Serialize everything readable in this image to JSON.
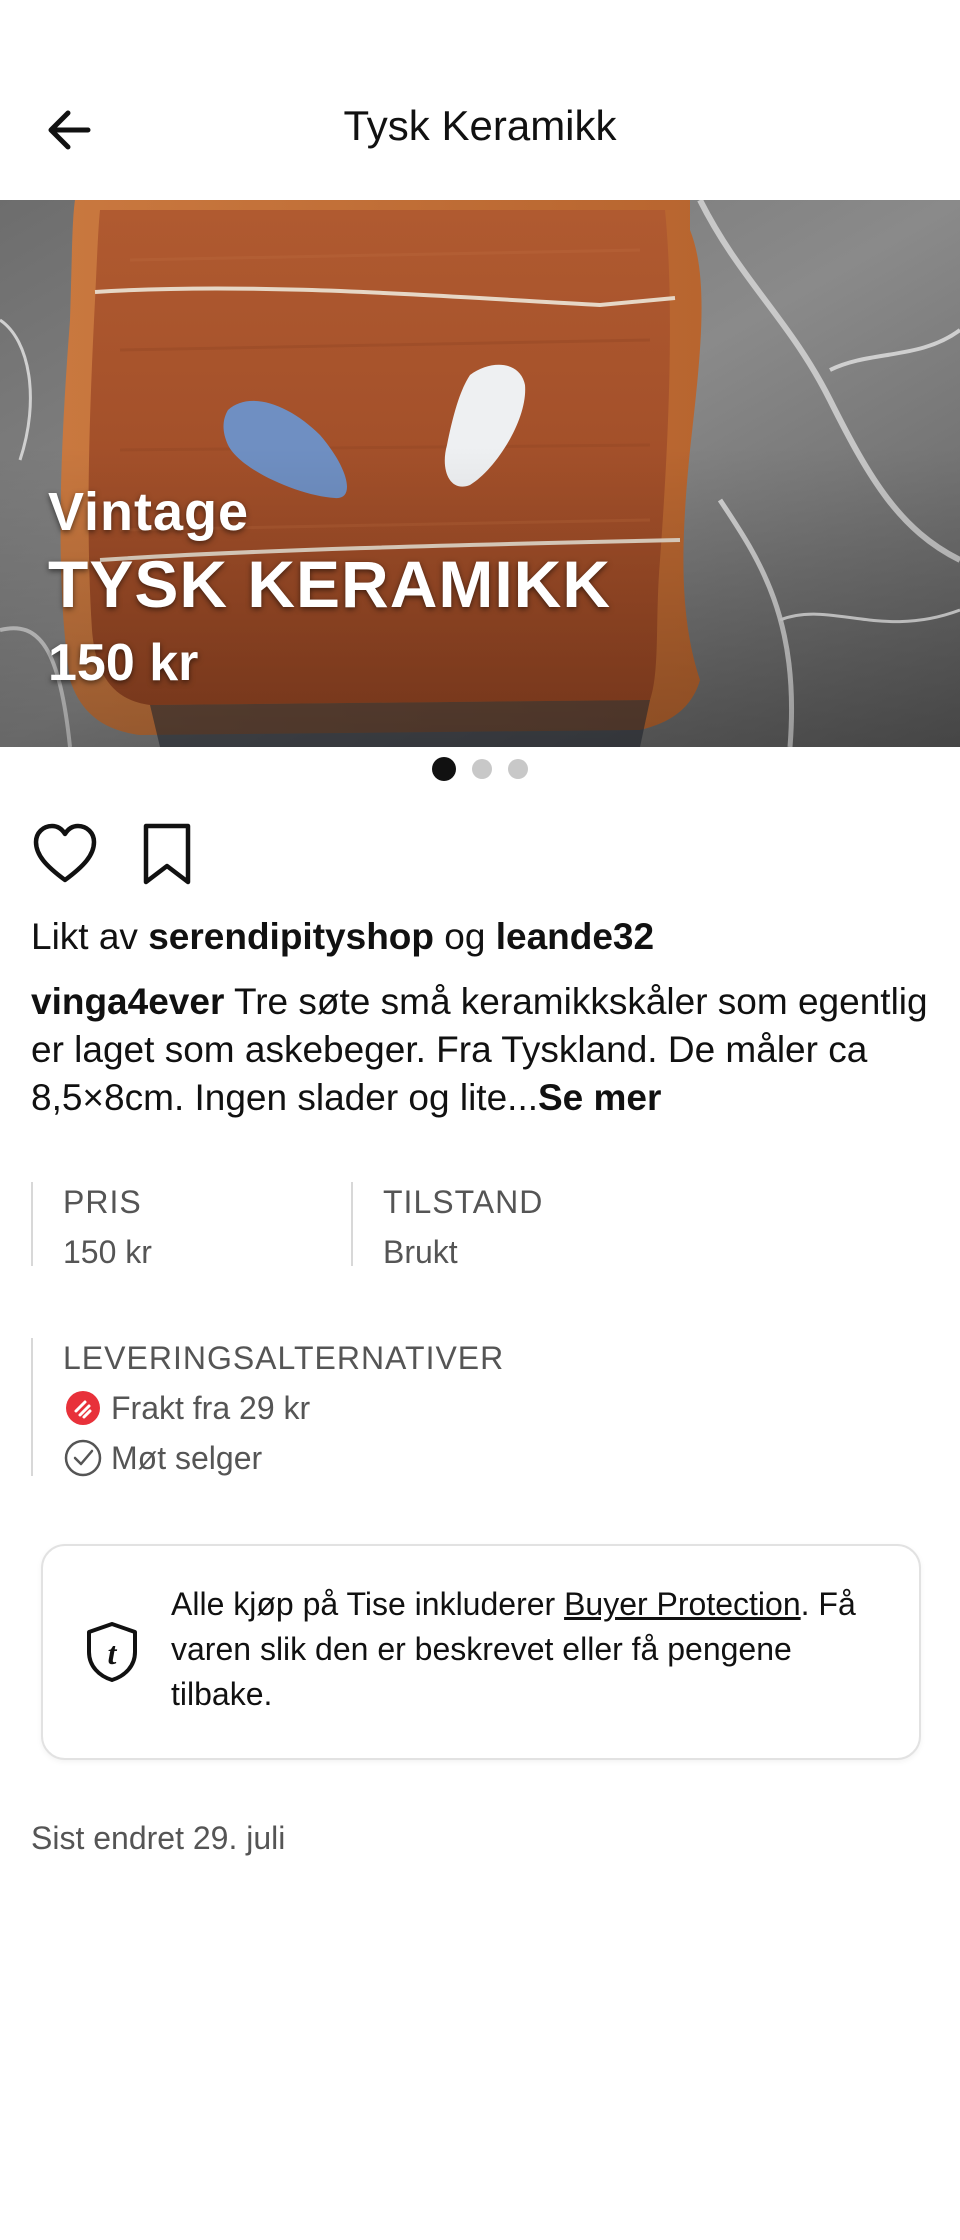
{
  "header": {
    "title": "Tysk Keramikk",
    "back_icon": "arrow-left-icon"
  },
  "hero": {
    "vintage": "Vintage",
    "title": "TYSK KERAMIKK",
    "price": "150 kr",
    "slide_count": 3,
    "active_slide": 1
  },
  "actions": {
    "like_icon": "heart-icon",
    "save_icon": "bookmark-icon"
  },
  "liked": {
    "prefix": "Likt av",
    "user1": "serendipityshop",
    "conj": "og",
    "user2": "leande32"
  },
  "description": {
    "user": "vinga4ever",
    "text": "Tre søte små keramikkskåler som egentlig er laget som askebeger. Fra Tyskland. De måler ca 8,5×8cm. Ingen slader og lite...",
    "more": "Se mer"
  },
  "details": {
    "price_label": "PRIS",
    "price_value": "150 kr",
    "condition_label": "TILSTAND",
    "condition_value": "Brukt"
  },
  "delivery": {
    "label": "LEVERINGSALTERNATIVER",
    "options": [
      {
        "icon": "shipping-icon",
        "text": "Frakt fra 29 kr"
      },
      {
        "icon": "check-circle-icon",
        "text": "Møt selger"
      }
    ]
  },
  "protection": {
    "icon": "shield-icon",
    "text_before": "Alle kjøp på Tise inkluderer ",
    "link": "Buyer Protection",
    "text_after": ". Få varen slik den er beskrevet eller få pengene tilbake."
  },
  "last_edited": "Sist endret 29. juli",
  "colors": {
    "accent_red": "#e8313a",
    "text": "#111111",
    "muted": "#555555"
  }
}
